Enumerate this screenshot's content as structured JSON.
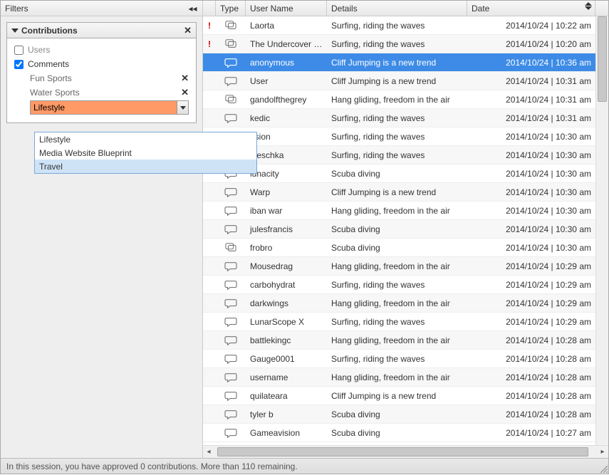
{
  "sidebar": {
    "title": "Filters",
    "panel": {
      "title": "Contributions",
      "users_label": "Users",
      "users_checked": false,
      "comments_label": "Comments",
      "comments_checked": true,
      "tags": [
        {
          "label": "Fun Sports"
        },
        {
          "label": "Water Sports"
        }
      ],
      "combo_value": "Lifestyle",
      "combo_options": [
        "Lifestyle",
        "Media Website Blueprint",
        "Travel"
      ],
      "combo_hover_index": 2
    }
  },
  "columns": {
    "type": "Type",
    "user": "User Name",
    "details": "Details",
    "date": "Date"
  },
  "rows": [
    {
      "alert": true,
      "multi": true,
      "user": "Laorta",
      "details": "Surfing, riding the waves",
      "date": "2014/10/24 | 10:22 am",
      "selected": false
    },
    {
      "alert": true,
      "multi": true,
      "user": "The Undercover …",
      "details": "Surfing, riding the waves",
      "date": "2014/10/24 | 10:20 am",
      "selected": false
    },
    {
      "alert": false,
      "multi": false,
      "user": "anonymous",
      "details": "Cliff Jumping is a new trend",
      "date": "2014/10/24 | 10:36 am",
      "selected": true
    },
    {
      "alert": false,
      "multi": false,
      "user": "User",
      "details": "Cliff Jumping is a new trend",
      "date": "2014/10/24 | 10:31 am",
      "selected": false
    },
    {
      "alert": false,
      "multi": true,
      "user": "gandolfthegrey",
      "details": "Hang gliding, freedom in the air",
      "date": "2014/10/24 | 10:31 am",
      "selected": false
    },
    {
      "alert": false,
      "multi": false,
      "user": "kedic",
      "details": "Surfing, riding the waves",
      "date": "2014/10/24 | 10:31 am",
      "selected": false
    },
    {
      "alert": false,
      "multi": false,
      "user": "dsion",
      "details": "Surfing, riding the waves",
      "date": "2014/10/24 | 10:30 am",
      "selected": false
    },
    {
      "alert": false,
      "multi": false,
      "user": "djeschka",
      "details": "Surfing, riding the waves",
      "date": "2014/10/24 | 10:30 am",
      "selected": false
    },
    {
      "alert": false,
      "multi": false,
      "user": "lunacity",
      "details": "Scuba diving",
      "date": "2014/10/24 | 10:30 am",
      "selected": false
    },
    {
      "alert": false,
      "multi": false,
      "user": "Warp",
      "details": "Cliff Jumping is a new trend",
      "date": "2014/10/24 | 10:30 am",
      "selected": false
    },
    {
      "alert": false,
      "multi": false,
      "user": "iban war",
      "details": "Hang gliding, freedom in the air",
      "date": "2014/10/24 | 10:30 am",
      "selected": false
    },
    {
      "alert": false,
      "multi": false,
      "user": "julesfrancis",
      "details": "Scuba diving",
      "date": "2014/10/24 | 10:30 am",
      "selected": false
    },
    {
      "alert": false,
      "multi": true,
      "user": "frobro",
      "details": "Scuba diving",
      "date": "2014/10/24 | 10:30 am",
      "selected": false
    },
    {
      "alert": false,
      "multi": false,
      "user": "Mousedrag",
      "details": "Hang gliding, freedom in the air",
      "date": "2014/10/24 | 10:29 am",
      "selected": false
    },
    {
      "alert": false,
      "multi": false,
      "user": "carbohydrat",
      "details": "Surfing, riding the waves",
      "date": "2014/10/24 | 10:29 am",
      "selected": false
    },
    {
      "alert": false,
      "multi": false,
      "user": "darkwings",
      "details": "Hang gliding, freedom in the air",
      "date": "2014/10/24 | 10:29 am",
      "selected": false
    },
    {
      "alert": false,
      "multi": false,
      "user": "LunarScope X",
      "details": "Surfing, riding the waves",
      "date": "2014/10/24 | 10:29 am",
      "selected": false
    },
    {
      "alert": false,
      "multi": false,
      "user": "battlekingc",
      "details": "Hang gliding, freedom in the air",
      "date": "2014/10/24 | 10:28 am",
      "selected": false
    },
    {
      "alert": false,
      "multi": false,
      "user": "Gauge0001",
      "details": "Surfing, riding the waves",
      "date": "2014/10/24 | 10:28 am",
      "selected": false
    },
    {
      "alert": false,
      "multi": false,
      "user": "username",
      "details": "Hang gliding, freedom in the air",
      "date": "2014/10/24 | 10:28 am",
      "selected": false
    },
    {
      "alert": false,
      "multi": false,
      "user": "quilateara",
      "details": "Cliff Jumping is a new trend",
      "date": "2014/10/24 | 10:28 am",
      "selected": false
    },
    {
      "alert": false,
      "multi": false,
      "user": "tyler b",
      "details": "Scuba diving",
      "date": "2014/10/24 | 10:28 am",
      "selected": false
    },
    {
      "alert": false,
      "multi": false,
      "user": "Gameavision",
      "details": "Scuba diving",
      "date": "2014/10/24 | 10:27 am",
      "selected": false
    }
  ],
  "status": "In this session, you have approved 0 contributions. More than 110 remaining."
}
